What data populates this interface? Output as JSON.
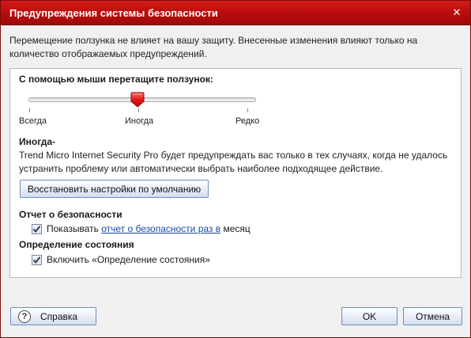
{
  "window": {
    "title": "Предупреждения системы безопасности",
    "close_glyph": "✕",
    "accent_color": "#c41414"
  },
  "info_text": "Перемещение ползунка не влияет на вашу защиту. Внесенные изменения влияют только на количество отображаемых предупреждений.",
  "slider": {
    "heading": "С помощью мыши перетащите ползунок:",
    "labels": [
      "Всегда",
      "Иногда",
      "Редко"
    ],
    "selected_index": 1
  },
  "level": {
    "name": "Иногда-",
    "description": "Trend Micro Internet Security Pro будет предупреждать вас только в тех случаях, когда не удалось устранить проблему или автоматически выбрать наиболее подходящее действие."
  },
  "restore_button": "Восстановить настройки по умолчанию",
  "security_report": {
    "heading": "Отчет о безопасности",
    "checkbox_prefix": "Показывать",
    "link_text": "отчет о безопасности раз в",
    "suffix": "месяц",
    "checked": true
  },
  "status_detection": {
    "heading": "Определение состояния",
    "checkbox_label": "Включить «Определение состояния»",
    "checked": true
  },
  "footer": {
    "help_label": "Справка",
    "help_icon": "?",
    "ok_label": "OK",
    "cancel_label": "Отмена"
  }
}
